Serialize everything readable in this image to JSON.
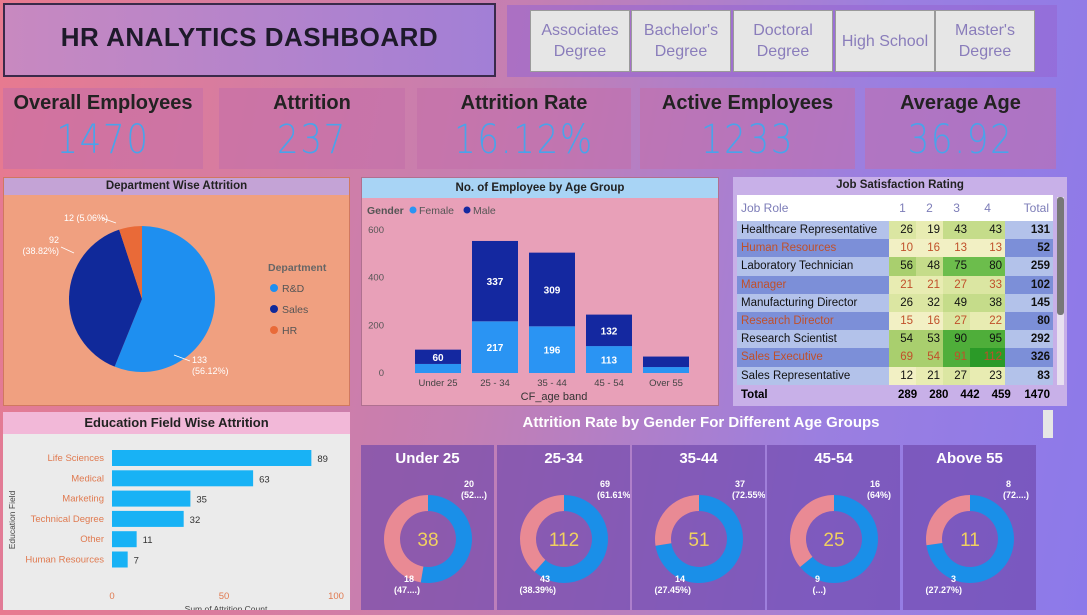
{
  "title": "HR ANALYTICS DASHBOARD",
  "slicers": [
    "Associates Degree",
    "Bachelor's Degree",
    "Doctoral Degree",
    "High School",
    "Master's Degree"
  ],
  "kpis": [
    {
      "label": "Overall Employees",
      "value": "1470"
    },
    {
      "label": "Attrition",
      "value": "237"
    },
    {
      "label": "Attrition Rate",
      "value": "16.12%"
    },
    {
      "label": "Active Employees",
      "value": "1233"
    },
    {
      "label": "Average Age",
      "value": "36.92"
    }
  ],
  "department": {
    "title": "Department Wise Attrition",
    "legend_title": "Department",
    "colors": {
      "rnd": "#1e8ff0",
      "sales": "#10299a",
      "hr": "#e96a38"
    },
    "chart_data": {
      "type": "pie",
      "categories": [
        "R&D",
        "Sales",
        "HR"
      ],
      "values": [
        133,
        92,
        12
      ],
      "labels": [
        "133 (56.12%)",
        "92 (38.82%)",
        "12 (5.06%)"
      ]
    }
  },
  "age_group": {
    "title": "No. of Employee by Age Group",
    "legend_title": "Gender",
    "legend_female": "Female",
    "legend_male": "Male",
    "xlabel": "CF_age band",
    "colors": {
      "female": "#2a94f3",
      "male": "#1428a0"
    },
    "chart_data": {
      "type": "bar",
      "categories": [
        "Under 25",
        "25 - 34",
        "35 - 44",
        "45 - 54",
        "Over 55"
      ],
      "series": [
        {
          "name": "Female",
          "values": [
            38,
            217,
            196,
            113,
            25
          ]
        },
        {
          "name": "Male",
          "values": [
            60,
            337,
            309,
            132,
            44
          ]
        }
      ],
      "data_labels": {
        "Female": [
          "",
          "217",
          "196",
          "113",
          ""
        ],
        "Male": [
          "60",
          "337",
          "309",
          "132",
          ""
        ]
      },
      "ylim": [
        0,
        600
      ],
      "yticks": [
        "0",
        "200",
        "400",
        "600"
      ],
      "stacked": true
    }
  },
  "job_satisfaction": {
    "title": "Job Satisfaction Rating",
    "columns": [
      "Job Role",
      "1",
      "2",
      "3",
      "4",
      "Total"
    ],
    "rows": [
      [
        "Healthcare Representative",
        "26",
        "19",
        "43",
        "43",
        "131"
      ],
      [
        "Human Resources",
        "10",
        "16",
        "13",
        "13",
        "52"
      ],
      [
        "Laboratory Technician",
        "56",
        "48",
        "75",
        "80",
        "259"
      ],
      [
        "Manager",
        "21",
        "21",
        "27",
        "33",
        "102"
      ],
      [
        "Manufacturing Director",
        "26",
        "32",
        "49",
        "38",
        "145"
      ],
      [
        "Research Director",
        "15",
        "16",
        "27",
        "22",
        "80"
      ],
      [
        "Research Scientist",
        "54",
        "53",
        "90",
        "95",
        "292"
      ],
      [
        "Sales Executive",
        "69",
        "54",
        "91",
        "112",
        "326"
      ],
      [
        "Sales Representative",
        "12",
        "21",
        "27",
        "23",
        "83"
      ]
    ],
    "total": [
      "Total",
      "289",
      "280",
      "442",
      "459",
      "1470"
    ]
  },
  "education": {
    "title": "Education Field Wise Attrition",
    "ylabel": "Education Field",
    "xlabel": "Sum of Attrition Count",
    "bar_color": "#18b2f5",
    "chart_data": {
      "type": "bar",
      "orientation": "horizontal",
      "categories": [
        "Life Sciences",
        "Medical",
        "Marketing",
        "Technical Degree",
        "Other",
        "Human Resources"
      ],
      "values": [
        89,
        63,
        35,
        32,
        11,
        7
      ],
      "xlim": [
        0,
        100
      ],
      "xticks": [
        "0",
        "50",
        "100"
      ]
    }
  },
  "gender_age": {
    "title": "Attrition Rate by Gender For Different Age Groups",
    "colors": {
      "male": "#1a8fe8",
      "female": "#e98a94"
    },
    "chart_data": [
      {
        "type": "pie",
        "title": "Under 25",
        "total": "38",
        "categories": [
          "Male",
          "Female"
        ],
        "values": [
          20,
          18
        ],
        "labels": [
          "20 (52....)",
          "18 (47....)"
        ]
      },
      {
        "type": "pie",
        "title": "25-34",
        "total": "112",
        "categories": [
          "Male",
          "Female"
        ],
        "values": [
          69,
          43
        ],
        "labels": [
          "69 (61.61%)",
          "43 (38.39%)"
        ]
      },
      {
        "type": "pie",
        "title": "35-44",
        "total": "51",
        "categories": [
          "Male",
          "Female"
        ],
        "values": [
          37,
          14
        ],
        "labels": [
          "37 (72.55%)",
          "14 (27.45%)"
        ]
      },
      {
        "type": "pie",
        "title": "45-54",
        "total": "25",
        "categories": [
          "Male",
          "Female"
        ],
        "values": [
          16,
          9
        ],
        "labels": [
          "16 (64%)",
          "9 (...)"
        ]
      },
      {
        "type": "pie",
        "title": "Above 55",
        "total": "11",
        "categories": [
          "Male",
          "Female"
        ],
        "values": [
          8,
          3
        ],
        "labels": [
          "8 (72....)",
          "3 (27.27%)"
        ]
      }
    ]
  }
}
